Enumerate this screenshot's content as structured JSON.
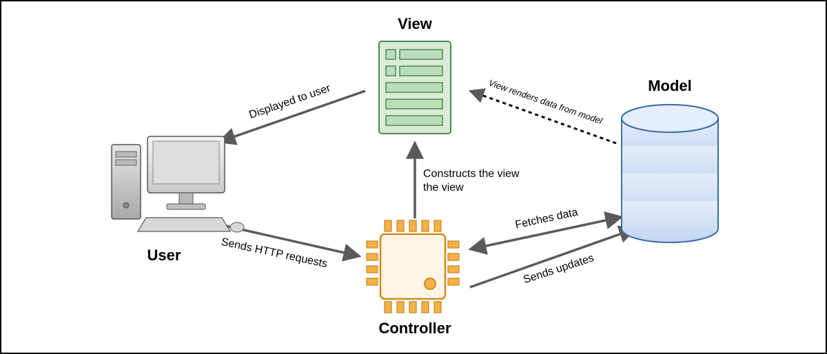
{
  "diagram": {
    "nodes": {
      "view": {
        "label": "View"
      },
      "model": {
        "label": "Model"
      },
      "user": {
        "label": "User"
      },
      "controller": {
        "label": "Controller"
      }
    },
    "edges": {
      "displayed_to_user": {
        "label": "Displayed to user",
        "from": "view",
        "to": "user",
        "style": "solid",
        "direction": "uni"
      },
      "view_renders": {
        "label": "View renders data from model",
        "from": "model",
        "to": "view",
        "style": "dotted",
        "direction": "uni"
      },
      "constructs_view": {
        "label": "Constructs the view",
        "from": "controller",
        "to": "view",
        "style": "solid",
        "direction": "uni"
      },
      "sends_http": {
        "label": "Sends HTTP requests",
        "from": "user",
        "to": "controller",
        "style": "solid",
        "direction": "uni"
      },
      "fetches_data": {
        "label": "Fetches data",
        "from": "controller",
        "to": "model",
        "style": "solid",
        "direction": "bi"
      },
      "sends_updates": {
        "label": "Sends updates",
        "from": "controller",
        "to": "model",
        "style": "solid",
        "direction": "uni"
      }
    },
    "constructs_line2": "the view"
  }
}
